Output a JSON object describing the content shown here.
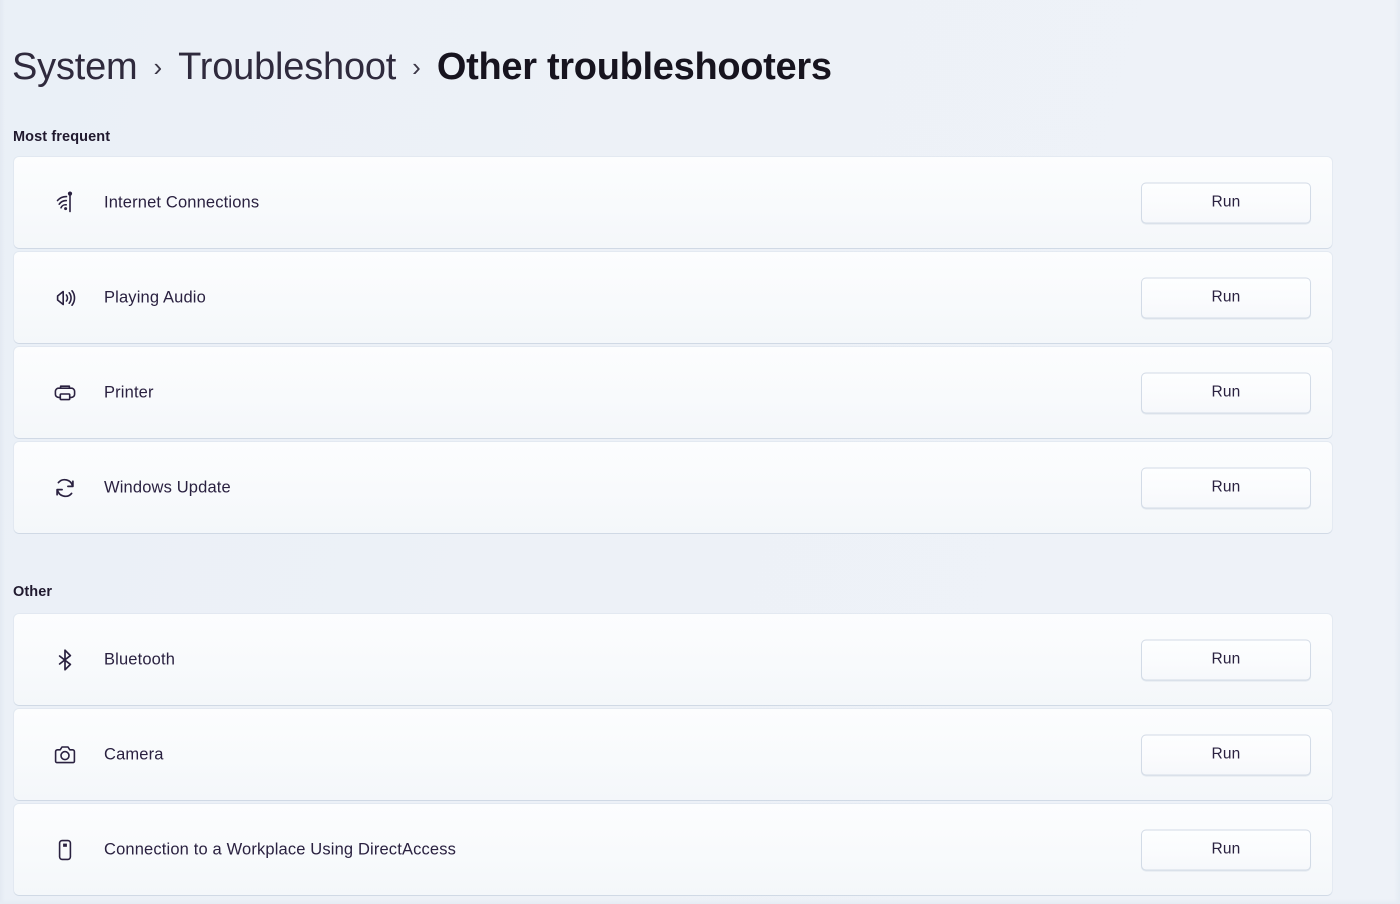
{
  "breadcrumb": {
    "items": [
      "System",
      "Troubleshoot"
    ],
    "separator": "›",
    "current": "Other troubleshooters"
  },
  "sections": [
    {
      "id": "most-frequent",
      "header": "Most frequent",
      "rows": [
        {
          "icon": "network-signal-icon",
          "label": "Internet Connections",
          "action": "Run"
        },
        {
          "icon": "speaker-volume-icon",
          "label": "Playing Audio",
          "action": "Run"
        },
        {
          "icon": "printer-icon",
          "label": "Printer",
          "action": "Run"
        },
        {
          "icon": "refresh-circular-arrows-icon",
          "label": "Windows Update",
          "action": "Run"
        }
      ]
    },
    {
      "id": "other",
      "header": "Other",
      "rows": [
        {
          "icon": "bluetooth-icon",
          "label": "Bluetooth",
          "action": "Run"
        },
        {
          "icon": "camera-icon",
          "label": "Camera",
          "action": "Run"
        },
        {
          "icon": "mobile-device-icon",
          "label": "Connection to a Workplace Using DirectAccess",
          "action": "Run"
        }
      ]
    }
  ],
  "colors": {
    "page_background": "#eef2f8",
    "card_background": "#fafcfe",
    "text_primary": "#2a2140",
    "breadcrumb_current": "#17141f",
    "card_border": "#cdd7e6"
  }
}
